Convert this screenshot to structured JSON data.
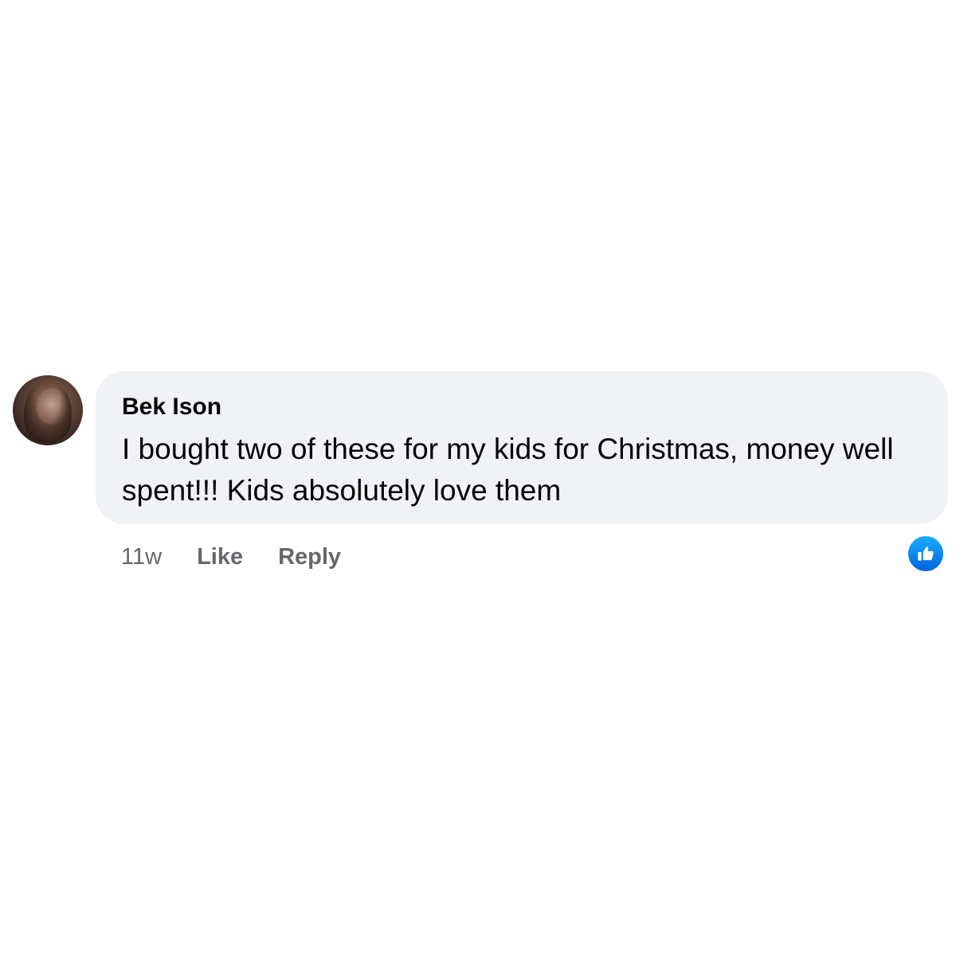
{
  "comment": {
    "author": "Bek Ison",
    "text": "I bought two of these for my kids for Christmas, money well spent!!! Kids absolutely love them",
    "timestamp": "11w",
    "actions": {
      "like_label": "Like",
      "reply_label": "Reply"
    },
    "reaction": {
      "type": "like",
      "icon": "thumbs-up-icon",
      "color": "#1877f2"
    }
  },
  "colors": {
    "bubble": "#f0f2f5",
    "text": "#050505",
    "secondary_text": "#65676b",
    "like_blue": "#1877f2"
  }
}
